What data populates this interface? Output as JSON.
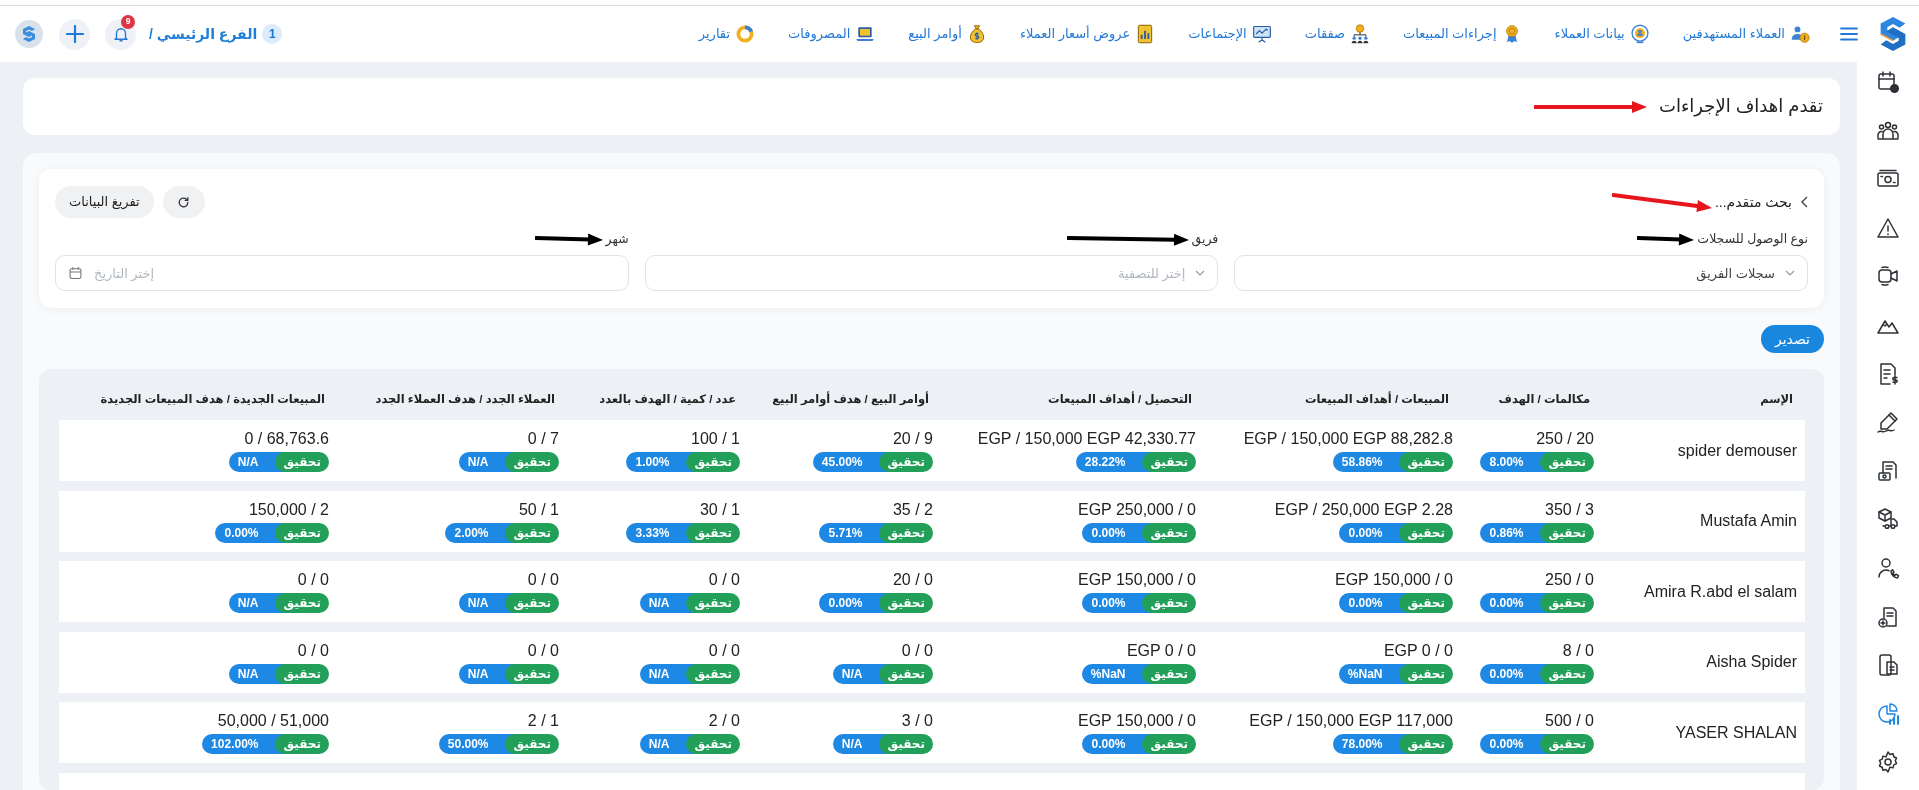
{
  "navbar": {
    "items": [
      {
        "label": "العملاء المستهدفين"
      },
      {
        "label": "بيانات العملاء"
      },
      {
        "label": "إجراءات المبيعات"
      },
      {
        "label": "صفقات"
      },
      {
        "label": "الإجتماعات"
      },
      {
        "label": "عروض أسعار العملاء"
      },
      {
        "label": "أوامر البيع"
      },
      {
        "label": "المصروفات"
      },
      {
        "label": "تقارير"
      }
    ],
    "branch": {
      "count": "1",
      "label": "الفرع الرئيسي /"
    },
    "notifications": {
      "count": "9"
    }
  },
  "sidebar": {
    "items": [
      {
        "selected": false
      },
      {
        "selected": false
      },
      {
        "selected": false
      },
      {
        "selected": false
      },
      {
        "selected": false
      },
      {
        "selected": false
      },
      {
        "selected": false
      },
      {
        "selected": false
      },
      {
        "selected": false
      },
      {
        "selected": false
      },
      {
        "selected": false
      },
      {
        "selected": false
      },
      {
        "selected": false
      },
      {
        "selected": true
      },
      {
        "selected": false
      }
    ]
  },
  "page_title": {
    "text": "تقدم اهداف الإجراءات",
    "arrow": {
      "color": "#e8151b"
    }
  },
  "advanced_search": {
    "title": "بحث متقدم...",
    "arrow": {
      "color": "#e8151b"
    },
    "clear_button": "تفريغ البيانات",
    "fields": [
      {
        "kind": "select",
        "label": "نوع الوصول للسجلات",
        "value": "سجلات الفريق",
        "arrow": {
          "color": "#000000"
        }
      },
      {
        "kind": "select",
        "label": "فريق",
        "placeholder": "إختر للتصفية",
        "arrow": {
          "color": "#000000"
        }
      },
      {
        "kind": "date",
        "label": "شهر",
        "placeholder": "إختر التاريخ",
        "arrow": {
          "color": "#000000"
        }
      }
    ]
  },
  "export_button": "تصدير",
  "table": {
    "columns": [
      "الإسم",
      "مكالمات / الهدف",
      "المبيعات / أهداف المبيعات",
      "التحصيل / أهداف المبيعات",
      "أوامر البيع / هدف أوامر البيع",
      "عدد / كمية / الهدف بالعدد",
      "العملاء الجدد / هدف العملاء الجدد",
      "المبيعات الجديدة / هدف المبيعات الجديدة"
    ],
    "rows": [
      {
        "cells": [
          {
            "kind": "name",
            "text": "spider demouser"
          },
          {
            "kind": "progress",
            "value": "250 / 20",
            "status": "تحقيق",
            "percent": "8.00%"
          },
          {
            "kind": "progress",
            "value": "EGP / 150,000 EGP 88,282.8",
            "status": "تحقيق",
            "percent": "58.86%"
          },
          {
            "kind": "progress",
            "value": "EGP / 150,000 EGP 42,330.77",
            "status": "تحقيق",
            "percent": "28.22%"
          },
          {
            "kind": "progress",
            "value": "20 / 9",
            "status": "تحقيق",
            "percent": "45.00%"
          },
          {
            "kind": "progress",
            "value": "100 / 1",
            "status": "تحقيق",
            "percent": "1.00%"
          },
          {
            "kind": "progress",
            "value": "0 / 7",
            "status": "تحقيق",
            "percent": "N/A"
          },
          {
            "kind": "progress",
            "value": "0 / 68,763.6",
            "status": "تحقيق",
            "percent": "N/A"
          }
        ]
      },
      {
        "cells": [
          {
            "kind": "name",
            "text": "Mustafa Amin"
          },
          {
            "kind": "progress",
            "value": "350 / 3",
            "status": "تحقيق",
            "percent": "0.86%"
          },
          {
            "kind": "progress",
            "value": "EGP / 250,000 EGP 2.28",
            "status": "تحقيق",
            "percent": "0.00%"
          },
          {
            "kind": "progress",
            "value": "EGP 250,000 / 0",
            "status": "تحقيق",
            "percent": "0.00%"
          },
          {
            "kind": "progress",
            "value": "35 / 2",
            "status": "تحقيق",
            "percent": "5.71%"
          },
          {
            "kind": "progress",
            "value": "30 / 1",
            "status": "تحقيق",
            "percent": "3.33%"
          },
          {
            "kind": "progress",
            "value": "50 / 1",
            "status": "تحقيق",
            "percent": "2.00%"
          },
          {
            "kind": "progress",
            "value": "150,000 / 2",
            "status": "تحقيق",
            "percent": "0.00%"
          }
        ]
      },
      {
        "cells": [
          {
            "kind": "name",
            "text": "Amira R.abd el salam"
          },
          {
            "kind": "progress",
            "value": "250 / 0",
            "status": "تحقيق",
            "percent": "0.00%"
          },
          {
            "kind": "progress",
            "value": "EGP 150,000 / 0",
            "status": "تحقيق",
            "percent": "0.00%"
          },
          {
            "kind": "progress",
            "value": "EGP 150,000 / 0",
            "status": "تحقيق",
            "percent": "0.00%"
          },
          {
            "kind": "progress",
            "value": "20 / 0",
            "status": "تحقيق",
            "percent": "0.00%"
          },
          {
            "kind": "progress",
            "value": "0 / 0",
            "status": "تحقيق",
            "percent": "N/A"
          },
          {
            "kind": "progress",
            "value": "0 / 0",
            "status": "تحقيق",
            "percent": "N/A"
          },
          {
            "kind": "progress",
            "value": "0 / 0",
            "status": "تحقيق",
            "percent": "N/A"
          }
        ]
      },
      {
        "cells": [
          {
            "kind": "name",
            "text": "Aisha Spider"
          },
          {
            "kind": "progress",
            "value": "8 / 0",
            "status": "تحقيق",
            "percent": "0.00%"
          },
          {
            "kind": "progress",
            "value": "EGP 0 / 0",
            "status": "تحقيق",
            "percent": "%NaN"
          },
          {
            "kind": "progress",
            "value": "EGP 0 / 0",
            "status": "تحقيق",
            "percent": "%NaN"
          },
          {
            "kind": "progress",
            "value": "0 / 0",
            "status": "تحقيق",
            "percent": "N/A"
          },
          {
            "kind": "progress",
            "value": "0 / 0",
            "status": "تحقيق",
            "percent": "N/A"
          },
          {
            "kind": "progress",
            "value": "0 / 0",
            "status": "تحقيق",
            "percent": "N/A"
          },
          {
            "kind": "progress",
            "value": "0 / 0",
            "status": "تحقيق",
            "percent": "N/A"
          }
        ]
      },
      {
        "cells": [
          {
            "kind": "name",
            "text": "YASER SHALAN"
          },
          {
            "kind": "progress",
            "value": "500 / 0",
            "status": "تحقيق",
            "percent": "0.00%"
          },
          {
            "kind": "progress",
            "value": "EGP / 150,000 EGP 117,000",
            "status": "تحقيق",
            "percent": "78.00%"
          },
          {
            "kind": "progress",
            "value": "EGP 150,000 / 0",
            "status": "تحقيق",
            "percent": "0.00%"
          },
          {
            "kind": "progress",
            "value": "3 / 0",
            "status": "تحقيق",
            "percent": "N/A"
          },
          {
            "kind": "progress",
            "value": "2 / 0",
            "status": "تحقيق",
            "percent": "N/A"
          },
          {
            "kind": "progress",
            "value": "2 / 1",
            "status": "تحقيق",
            "percent": "50.00%"
          },
          {
            "kind": "progress",
            "value": "50,000 / 51,000",
            "status": "تحقيق",
            "percent": "102.00%"
          }
        ]
      }
    ]
  }
}
